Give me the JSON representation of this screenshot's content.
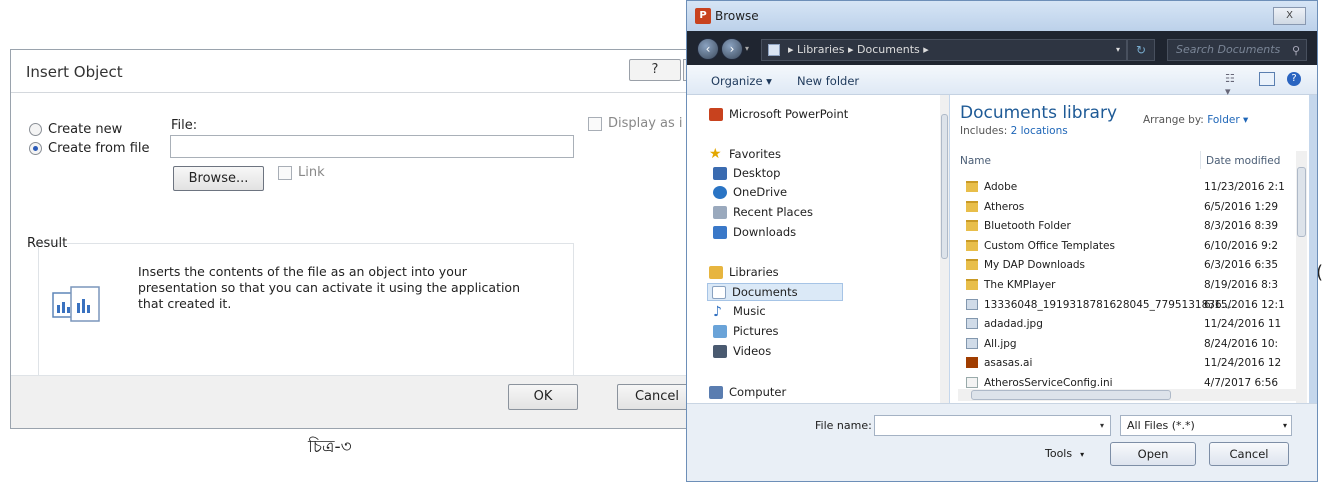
{
  "insert_object": {
    "title": "Insert Object",
    "help_label": "?",
    "radio_create_new": "Create new",
    "radio_create_from_file": "Create from file",
    "selected_option": "Create from file",
    "file_label": "File:",
    "file_value": "",
    "browse_label": "Browse...",
    "link_label": "Link",
    "display_as_icon_label": "Display as i",
    "result_label": "Result",
    "result_text": "Inserts the contents of the file as an object into your presentation so that you can activate it using the application that created it.",
    "ok_label": "OK",
    "cancel_label": "Cancel"
  },
  "caption": "চিত্র-৩",
  "stray_char": "(",
  "browse": {
    "title": "Browse",
    "close_label": "X",
    "breadcrumb": [
      "Libraries",
      "Documents"
    ],
    "address_text": "▸ Libraries ▸ Documents ▸",
    "search_placeholder": "Search Documents",
    "toolbar": {
      "organize": "Organize ▾",
      "new_folder": "New folder"
    },
    "nav": {
      "app_item": "Microsoft PowerPoint",
      "favorites": "Favorites",
      "favorites_items": [
        "Desktop",
        "OneDrive",
        "Recent Places",
        "Downloads"
      ],
      "libraries": "Libraries",
      "libraries_items": [
        "Documents",
        "Music",
        "Pictures",
        "Videos"
      ],
      "computer": "Computer"
    },
    "library": {
      "title": "Documents library",
      "includes_label": "Includes:",
      "includes_value": "2 locations",
      "arrange_label": "Arrange by:",
      "arrange_value": "Folder ▾"
    },
    "columns": [
      "Name",
      "Date modified"
    ],
    "files": [
      {
        "name": "Adobe",
        "date": "11/23/2016 2:1",
        "type": "folder"
      },
      {
        "name": "Atheros",
        "date": "6/5/2016 1:29",
        "type": "folder"
      },
      {
        "name": "Bluetooth Folder",
        "date": "8/3/2016 8:39",
        "type": "folder"
      },
      {
        "name": "Custom Office Templates",
        "date": "6/10/2016 9:2",
        "type": "folder"
      },
      {
        "name": "My DAP Downloads",
        "date": "6/3/2016 6:35",
        "type": "folder"
      },
      {
        "name": "The KMPlayer",
        "date": "8/19/2016 8:3",
        "type": "folder"
      },
      {
        "name": "13336048_1919318781628045_7795131836...",
        "date": "6/15/2016 12:1",
        "type": "image"
      },
      {
        "name": "adadad.jpg",
        "date": "11/24/2016 11",
        "type": "image"
      },
      {
        "name": "All.jpg",
        "date": "8/24/2016 10:",
        "type": "image"
      },
      {
        "name": "asasas.ai",
        "date": "11/24/2016 12",
        "type": "ai"
      },
      {
        "name": "AtherosServiceConfig.ini",
        "date": "4/7/2017 6:56",
        "type": "ini"
      }
    ],
    "file_name_label": "File name:",
    "file_name_value": "",
    "file_type_value": "All Files (*.*)",
    "tools_label": "Tools",
    "open_label": "Open",
    "cancel_label": "Cancel"
  }
}
